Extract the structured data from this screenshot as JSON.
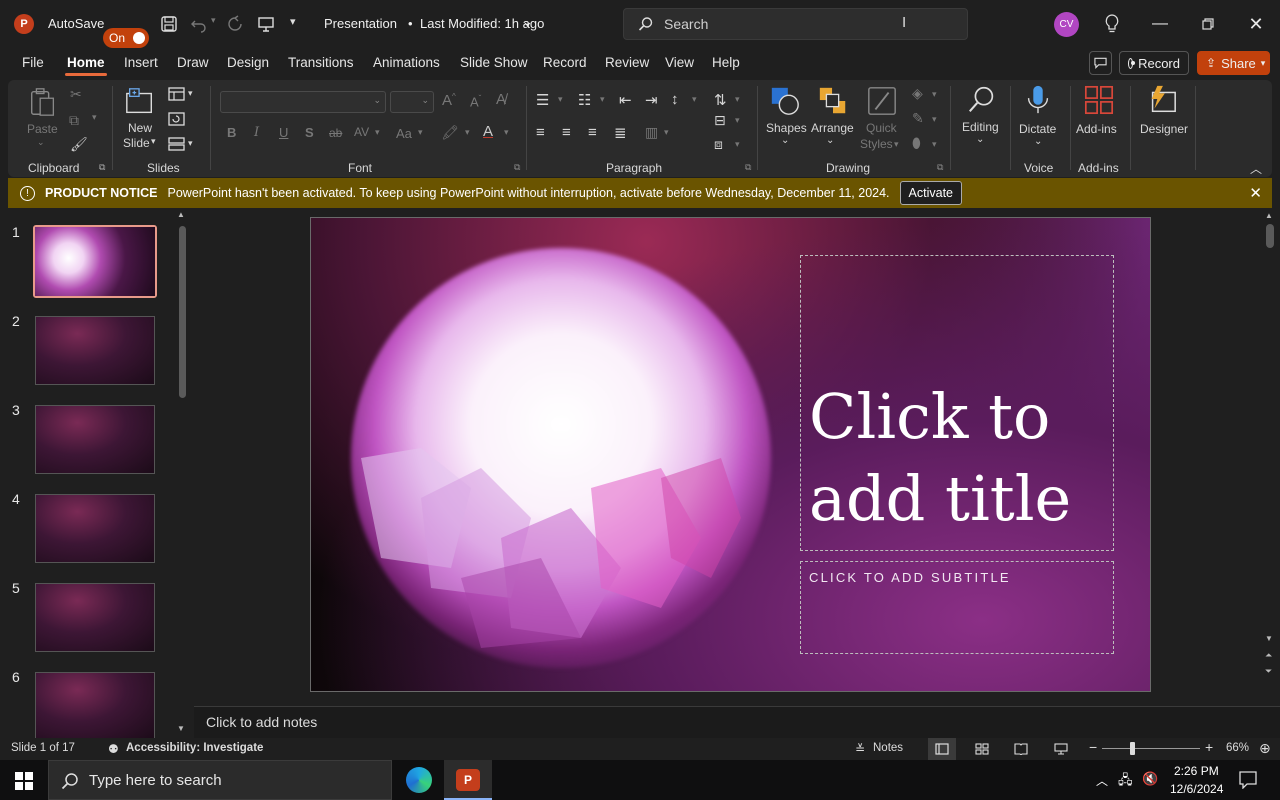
{
  "titlebar": {
    "autosave_label": "AutoSave",
    "autosave_state": "On",
    "doc_title": "Presentation",
    "modified": "Last Modified: 1h ago",
    "search_placeholder": "Search",
    "avatar_initials": "CV"
  },
  "tabs": [
    "File",
    "Home",
    "Insert",
    "Draw",
    "Design",
    "Transitions",
    "Animations",
    "Slide Show",
    "Record",
    "Review",
    "View",
    "Help"
  ],
  "active_tab": "Home",
  "actions": {
    "record": "Record",
    "share": "Share"
  },
  "ribbon": {
    "clipboard": {
      "label": "Clipboard",
      "paste": "Paste"
    },
    "slides": {
      "label": "Slides",
      "new_slide_1": "New",
      "new_slide_2": "Slide"
    },
    "font": {
      "label": "Font"
    },
    "paragraph": {
      "label": "Paragraph"
    },
    "drawing": {
      "label": "Drawing",
      "shapes": "Shapes",
      "arrange": "Arrange",
      "quick_styles_1": "Quick",
      "quick_styles_2": "Styles"
    },
    "voice": {
      "label": "Voice",
      "dictate": "Dictate"
    },
    "editing": {
      "label": "Editing"
    },
    "addins": {
      "label": "Add-ins",
      "addins_btn": "Add-ins",
      "designer": "Designer"
    }
  },
  "notice": {
    "title": "PRODUCT NOTICE",
    "message": "PowerPoint hasn't been activated. To keep using PowerPoint without interruption, activate before Wednesday, December 11, 2024.",
    "button": "Activate"
  },
  "thumbnails": [
    "1",
    "2",
    "3",
    "4",
    "5",
    "6"
  ],
  "slide": {
    "title_placeholder": "Click to add title",
    "subtitle_placeholder": "CLICK TO ADD SUBTITLE"
  },
  "notes_placeholder": "Click to add notes",
  "status": {
    "slide_counter": "Slide 1 of 17",
    "accessibility": "Accessibility: Investigate",
    "notes": "Notes",
    "zoom": "66%"
  },
  "taskbar": {
    "search_placeholder": "Type here to search",
    "time": "2:26 PM",
    "date": "12/6/2024"
  },
  "colors": {
    "accent": "#c2410c",
    "notice": "#6a5400",
    "tab_underline": "#e86a3b"
  }
}
